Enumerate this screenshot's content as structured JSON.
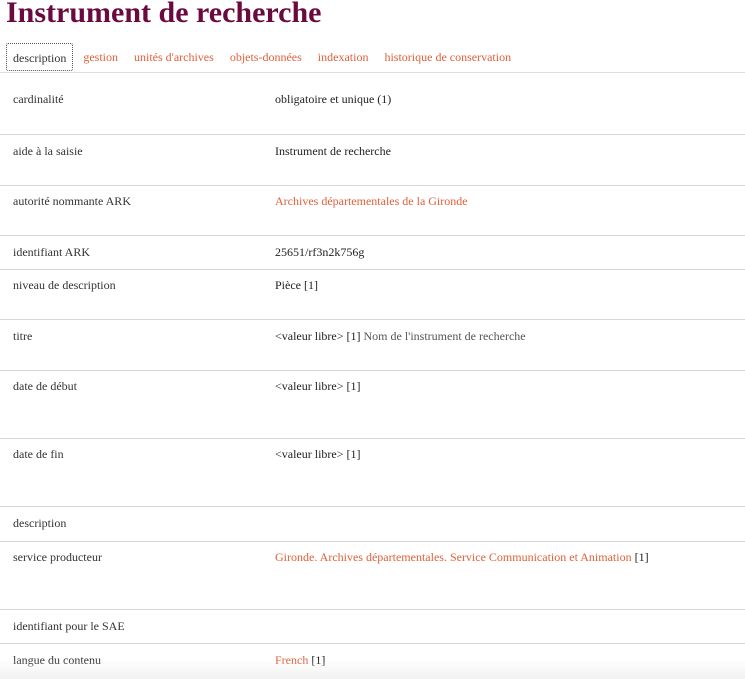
{
  "page": {
    "title": "Instrument de recherche"
  },
  "tabs": [
    {
      "label": "description",
      "active": true
    },
    {
      "label": "gestion"
    },
    {
      "label": "unités d'archives"
    },
    {
      "label": "objets-données"
    },
    {
      "label": "indexation"
    },
    {
      "label": "historique de conservation"
    }
  ],
  "rows": {
    "cardinalite": {
      "label": "cardinalité",
      "value": "obligatoire et unique (1)"
    },
    "aide": {
      "label": "aide à la saisie",
      "value": "Instrument de recherche"
    },
    "autorite": {
      "label": "autorité nommante ARK",
      "link": "Archives départementales de la Gironde"
    },
    "identifiant": {
      "label": "identifiant ARK",
      "value": "25651/rf3n2k756g"
    },
    "niveau": {
      "label": "niveau de description",
      "value": "Pièce [1]"
    },
    "titre": {
      "label": "titre",
      "value": "<valeur libre> [1]",
      "note": "Nom de l'instrument de recherche"
    },
    "debut": {
      "label": "date de début",
      "value": "<valeur libre> [1]"
    },
    "fin": {
      "label": "date de fin",
      "value": "<valeur libre> [1]"
    },
    "description": {
      "label": "description"
    },
    "service": {
      "label": "service producteur",
      "link": "Gironde. Archives départementales. Service Communication et Animation",
      "suffix": "[1]"
    },
    "sae": {
      "label": "identifiant pour le SAE"
    },
    "langue": {
      "label": "langue du contenu",
      "link": "French",
      "suffix": "[1]"
    }
  },
  "colors": {
    "title": "#6b0a3e",
    "link": "#e0603a"
  }
}
